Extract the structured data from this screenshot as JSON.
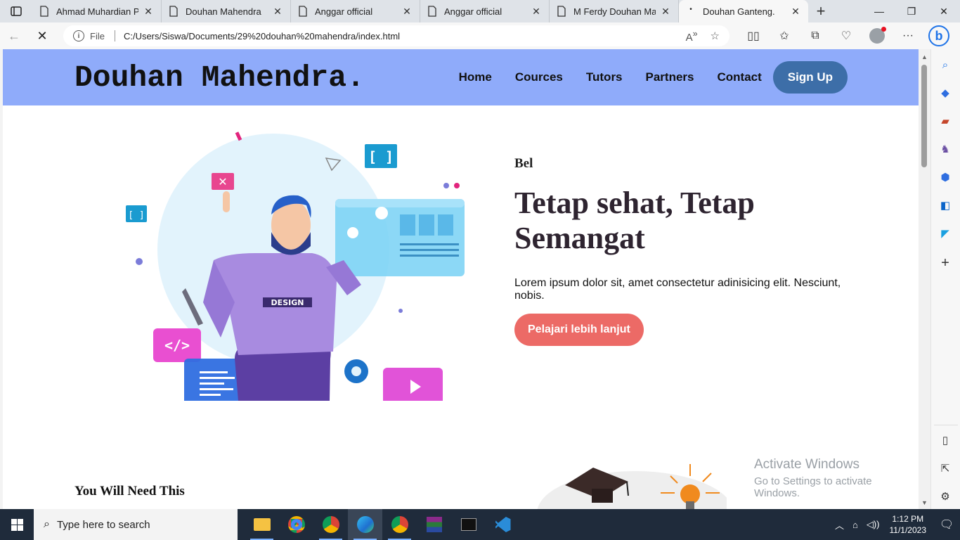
{
  "browser": {
    "tabs": [
      {
        "title": "Ahmad Muhardian Per",
        "active": false
      },
      {
        "title": "Douhan Mahendra",
        "active": false
      },
      {
        "title": "Anggar official",
        "active": false
      },
      {
        "title": "Anggar official",
        "active": false
      },
      {
        "title": "M Ferdy Douhan Mah",
        "active": false
      },
      {
        "title": "Douhan Ganteng.",
        "active": true
      }
    ],
    "new_tab_label": "+",
    "address": {
      "scheme_label": "File",
      "url": "C:/Users/Siswa/Documents/29%20douhan%20mahendra/index.html"
    }
  },
  "site": {
    "logo": "Douhan Mahendra.",
    "nav": [
      "Home",
      "Cources",
      "Tutors",
      "Partners",
      "Contact"
    ],
    "signup_label": "Sign Up",
    "hero": {
      "eyebrow": "Bel",
      "title": "Tetap sehat, Tetap Semangat",
      "description": "Lorem ipsum dolor sit, amet consectetur adinisicing elit. Nesciunt, nobis.",
      "cta_label": "Pelajari lebih lanjut",
      "illustration_badge": "DESIGN"
    },
    "section_title": "You Will Need This"
  },
  "watermark": {
    "line1": "Activate Windows",
    "line2": "Go to Settings to activate Windows."
  },
  "taskbar": {
    "search_placeholder": "Type here to search",
    "time": "1:12 PM",
    "date": "11/1/2023"
  },
  "colors": {
    "header_bg": "#8fabfa",
    "signup_bg": "#3d6ea8",
    "cta_bg": "#ec6a66",
    "title_color": "#2e2430"
  }
}
